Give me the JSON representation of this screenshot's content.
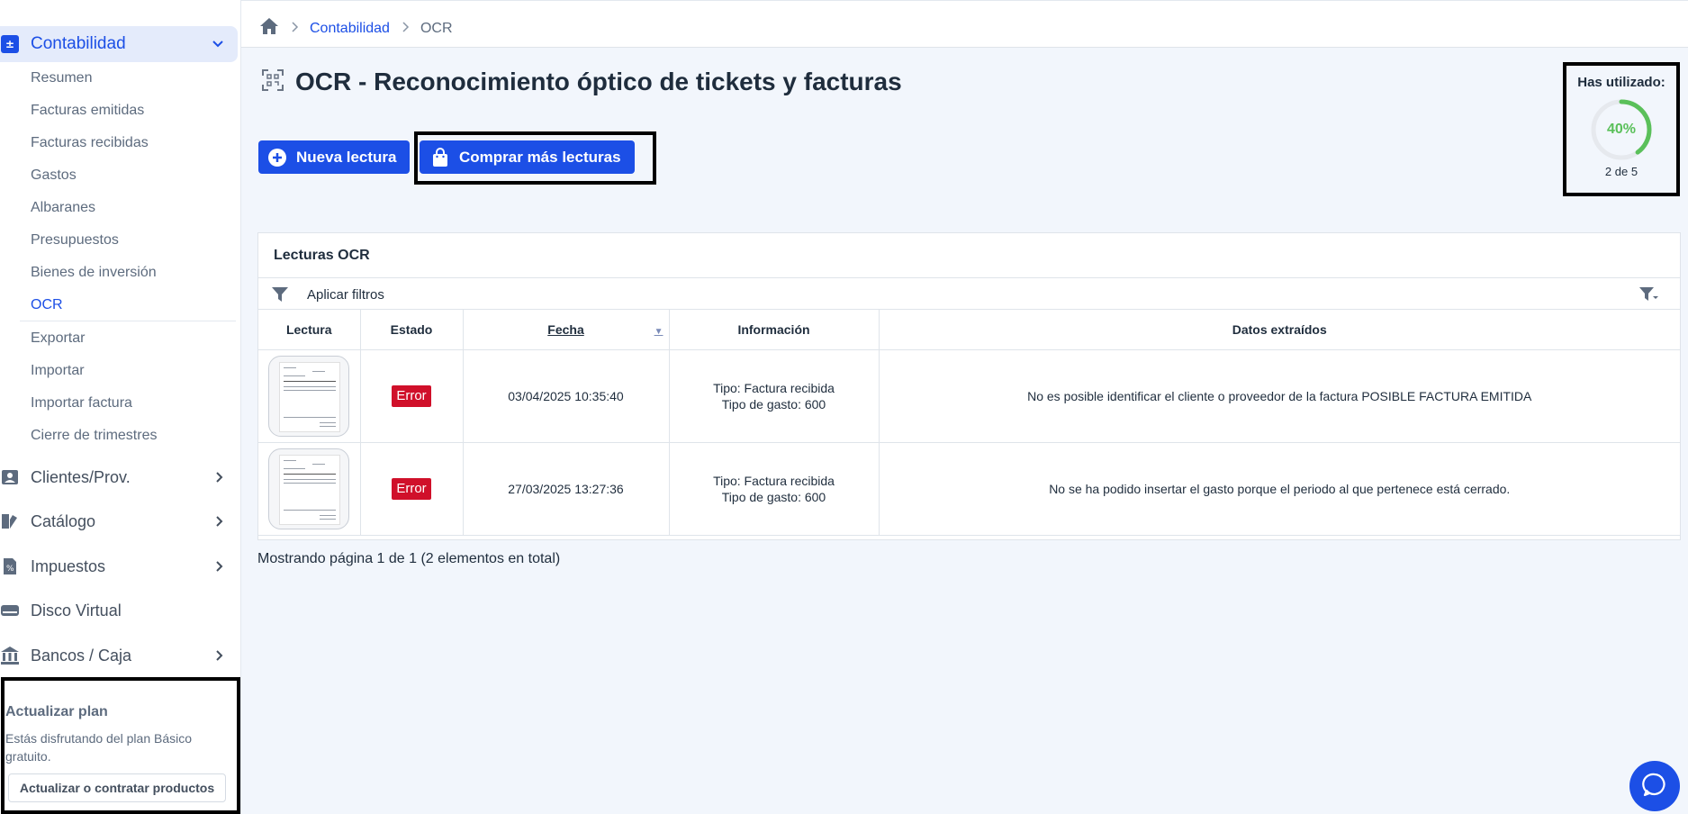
{
  "breadcrumb": {
    "items": [
      "Contabilidad",
      "OCR"
    ]
  },
  "sidebar": {
    "active_section": "Contabilidad",
    "sub_items": [
      "Resumen",
      "Facturas emitidas",
      "Facturas recibidas",
      "Gastos",
      "Albaranes",
      "Presupuestos",
      "Bienes de inversión",
      "OCR",
      "Exportar",
      "Importar",
      "Importar factura",
      "Cierre de trimestres"
    ],
    "active_sub_item": "OCR",
    "main_items": [
      "Clientes/Prov.",
      "Catálogo",
      "Impuestos",
      "Disco Virtual",
      "Bancos / Caja"
    ]
  },
  "upgrade": {
    "title": "Actualizar plan",
    "text": "Estás disfrutando del plan Básico gratuito.",
    "button": "Actualizar o contratar productos"
  },
  "page": {
    "title": "OCR - Reconocimiento óptico de tickets y facturas"
  },
  "actions": {
    "new_reading": "Nueva lectura",
    "buy_more": "Comprar más lecturas"
  },
  "usage": {
    "title": "Has utilizado:",
    "percent_label": "40%",
    "percent": 40,
    "count": "2 de 5"
  },
  "panel": {
    "title": "Lecturas OCR",
    "filter_label": "Aplicar filtros"
  },
  "table": {
    "headers": [
      "Lectura",
      "Estado",
      "Fecha",
      "Información",
      "Datos extraídos"
    ],
    "rows": [
      {
        "estado": "Error",
        "fecha": "03/04/2025 10:35:40",
        "info_tipo": "Tipo: Factura recibida",
        "info_gasto": "Tipo de gasto: 600",
        "datos": "No es posible identificar el cliente o proveedor de la factura POSIBLE FACTURA EMITIDA"
      },
      {
        "estado": "Error",
        "fecha": "27/03/2025 13:27:36",
        "info_tipo": "Tipo: Factura recibida",
        "info_gasto": "Tipo de gasto: 600",
        "datos": "No se ha podido insertar el gasto porque el periodo al que pertenece está cerrado."
      }
    ]
  },
  "pager": {
    "text": "Mostrando página 1 de 1 (2 elementos en total)"
  },
  "colors": {
    "accent": "#1c4fe6",
    "error": "#d0102a",
    "usage_ring": "#5ac05a",
    "background": "#f2f6fc"
  },
  "icons": [
    "calculator-icon",
    "chevron-down-icon",
    "chevron-right-icon",
    "contacts-icon",
    "catalog-icon",
    "taxes-icon",
    "virtual-disk-icon",
    "bank-icon",
    "home-icon",
    "ocr-scan-icon",
    "plus-circle-icon",
    "shopping-bag-icon",
    "filter-icon",
    "filter-dropdown-icon",
    "chat-icon"
  ]
}
